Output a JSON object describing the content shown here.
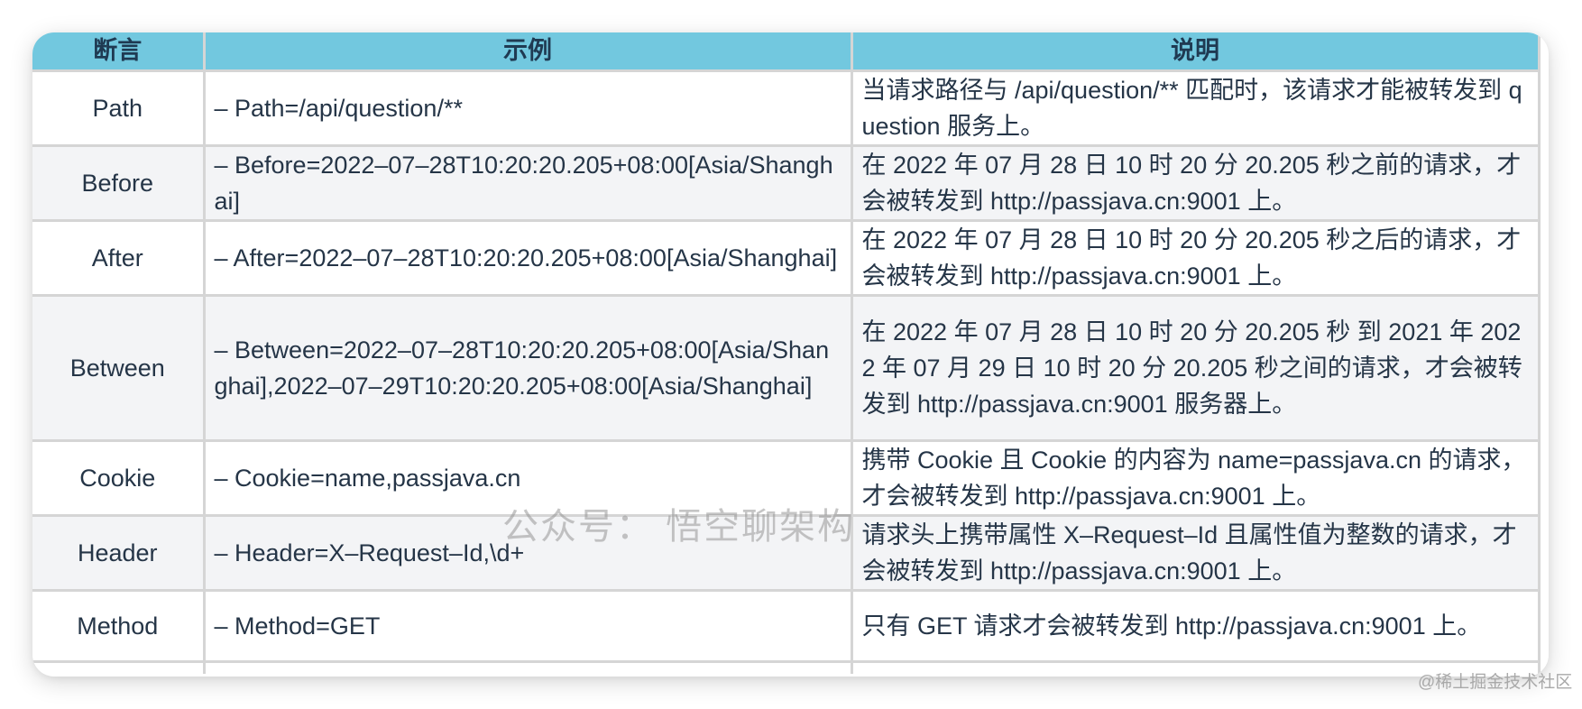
{
  "table": {
    "headers": [
      "断言",
      "示例",
      "说明"
    ],
    "rows": [
      {
        "predicate": "Path",
        "example": "– Path=/api/question/**",
        "description": "当请求路径与 /api/question/**  匹配时，该请求才能被转发到 question 服务上。"
      },
      {
        "predicate": "Before",
        "example": "– Before=2022–07–28T10:20:20.205+08:00[Asia/Shanghai]",
        "description": "在 2022 年 07 月 28 日 10 时 20 分 20.205 秒之前的请求，才会被转发到 http://passjava.cn:9001 上。"
      },
      {
        "predicate": "After",
        "example": "– After=2022–07–28T10:20:20.205+08:00[Asia/Shanghai]",
        "description": "在 2022 年 07 月 28 日 10 时 20 分 20.205 秒之后的请求，才会被转发到 http://passjava.cn:9001 上。"
      },
      {
        "predicate": "Between",
        "example": "– Between=2022–07–28T10:20:20.205+08:00[Asia/Shanghai],2022–07–29T10:20:20.205+08:00[Asia/Shanghai]",
        "description": "在 2022 年 07 月 28 日 10 时 20 分 20.205 秒 到 2021 年 2022 年 07 月 29 日 10 时 20 分 20.205 秒之间的请求，才会被转发到 http://passjava.cn:9001 服务器上。"
      },
      {
        "predicate": "Cookie",
        "example": "– Cookie=name,passjava.cn",
        "description": "携带 Cookie 且 Cookie 的内容为 name=passjava.cn 的请求，才会被转发到 http://passjava.cn:9001 上。"
      },
      {
        "predicate": "Header",
        "example": "– Header=X–Request–Id,\\d+",
        "description": "请求头上携带属性 X–Request–Id 且属性值为整数的请求，才会被转发到 http://passjava.cn:9001 上。"
      },
      {
        "predicate": "Method",
        "example": "– Method=GET",
        "description": "只有 GET 请求才会被转发到 http://passjava.cn:9001 上。"
      }
    ]
  },
  "watermarks": {
    "center": "公众号： 悟空聊架构",
    "corner": "@稀土掘金技术社区"
  },
  "colors": {
    "header_bg": "#72c8df",
    "header_text": "#1f3a52",
    "alt_row_bg": "#f3f4f6",
    "border": "#d5d5d5"
  }
}
